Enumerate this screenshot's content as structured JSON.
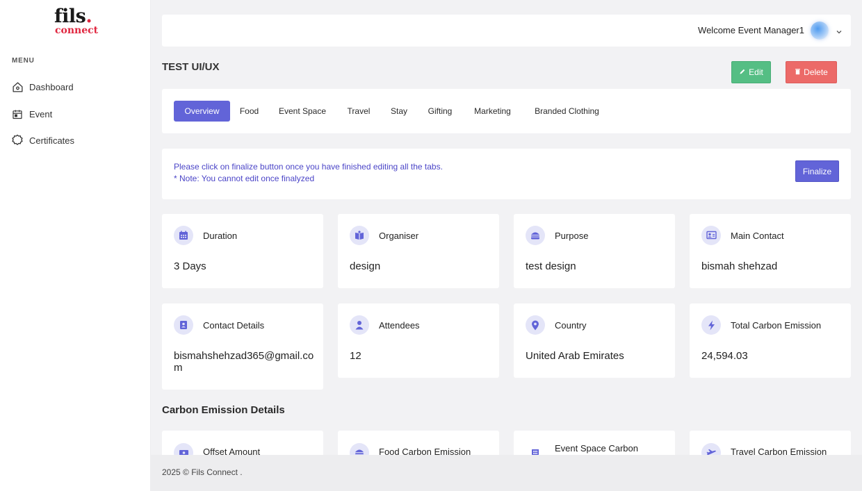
{
  "brand": {
    "line1": "fils",
    "line1_dot": ".",
    "line2": "connect"
  },
  "sidebar": {
    "menu_label": "MENU",
    "items": [
      {
        "label": "Dashboard",
        "icon": "home-icon"
      },
      {
        "label": "Event",
        "icon": "calendar-icon"
      },
      {
        "label": "Certificates",
        "icon": "certificate-icon"
      }
    ]
  },
  "header": {
    "welcome": "Welcome Event Manager1"
  },
  "page": {
    "title": "TEST UI/UX",
    "edit_label": "Edit",
    "delete_label": "Delete"
  },
  "tabs": [
    {
      "label": "Overview",
      "active": true
    },
    {
      "label": "Food",
      "active": false
    },
    {
      "label": "Event Space",
      "active": false
    },
    {
      "label": "Travel",
      "active": false
    },
    {
      "label": "Stay",
      "active": false
    },
    {
      "label": "Gifting",
      "active": false
    },
    {
      "label": "Marketing",
      "active": false
    },
    {
      "label": "Branded Clothing",
      "active": false
    }
  ],
  "notice": {
    "line1": "Please click on finalize button once you have finished editing all the tabs.",
    "line2": "* Note: You cannot edit once finalyzed",
    "finalize_label": "Finalize"
  },
  "stats": [
    {
      "label": "Duration",
      "value": "3 Days",
      "icon": "calendar-grid-icon"
    },
    {
      "label": "Organiser",
      "value": "design",
      "icon": "book-icon"
    },
    {
      "label": "Purpose",
      "value": "test design",
      "icon": "burger-icon"
    },
    {
      "label": "Main Contact",
      "value": "bismah shehzad",
      "icon": "contact-card-icon"
    },
    {
      "label": "Contact Details",
      "value": "bismahshehzad365@gmail.com",
      "icon": "id-badge-icon"
    },
    {
      "label": "Attendees",
      "value": "12",
      "icon": "user-icon"
    },
    {
      "label": "Country",
      "value": "United Arab Emirates",
      "icon": "map-pin-icon"
    },
    {
      "label": "Total Carbon Emission",
      "value": "24,594.03",
      "icon": "bolt-icon"
    }
  ],
  "carbon": {
    "title": "Carbon Emission Details",
    "cards": [
      {
        "label": "Offset Amount",
        "icon": "money-icon"
      },
      {
        "label": "Food Carbon Emission",
        "icon": "burger-icon"
      },
      {
        "label": "Event Space Carbon",
        "icon": "building-icon"
      },
      {
        "label": "Travel Carbon Emission",
        "icon": "plane-icon"
      }
    ]
  },
  "footer": {
    "text": "2025 © Fils Connect ."
  },
  "colors": {
    "accent": "#6264d8",
    "edit": "#55be84",
    "delete": "#ec6a68",
    "icon_bg": "#e4e5f8",
    "icon_fg": "#6264d8",
    "notice_text": "#4a44c7"
  }
}
